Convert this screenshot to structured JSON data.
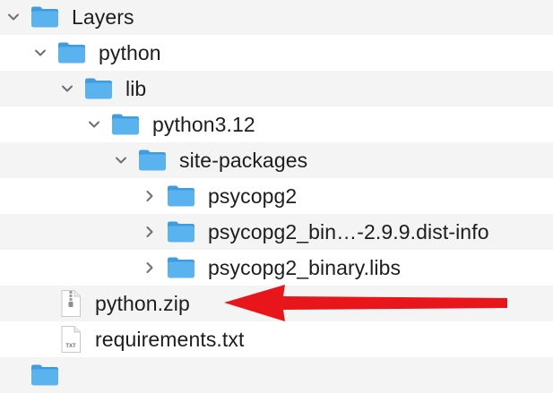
{
  "tree": {
    "rows": [
      {
        "label": "Layers",
        "kind": "folder",
        "expanded": true
      },
      {
        "label": "python",
        "kind": "folder",
        "expanded": true
      },
      {
        "label": "lib",
        "kind": "folder",
        "expanded": true
      },
      {
        "label": "python3.12",
        "kind": "folder",
        "expanded": true
      },
      {
        "label": "site-packages",
        "kind": "folder",
        "expanded": true
      },
      {
        "label": "psycopg2",
        "kind": "folder",
        "expanded": false
      },
      {
        "label": "psycopg2_bin…-2.9.9.dist-info",
        "kind": "folder",
        "expanded": false
      },
      {
        "label": "psycopg2_binary.libs",
        "kind": "folder",
        "expanded": false
      },
      {
        "label": "python.zip",
        "kind": "zip-file"
      },
      {
        "label": "requirements.txt",
        "kind": "txt-file",
        "icon_text": "TXT"
      }
    ]
  },
  "colors": {
    "folder": "#5ab3ee",
    "folder_tab": "#3d9de0",
    "arrow": "#e8151b",
    "alt_row": "#f4f4f4",
    "chevron": "#6e6e73"
  }
}
